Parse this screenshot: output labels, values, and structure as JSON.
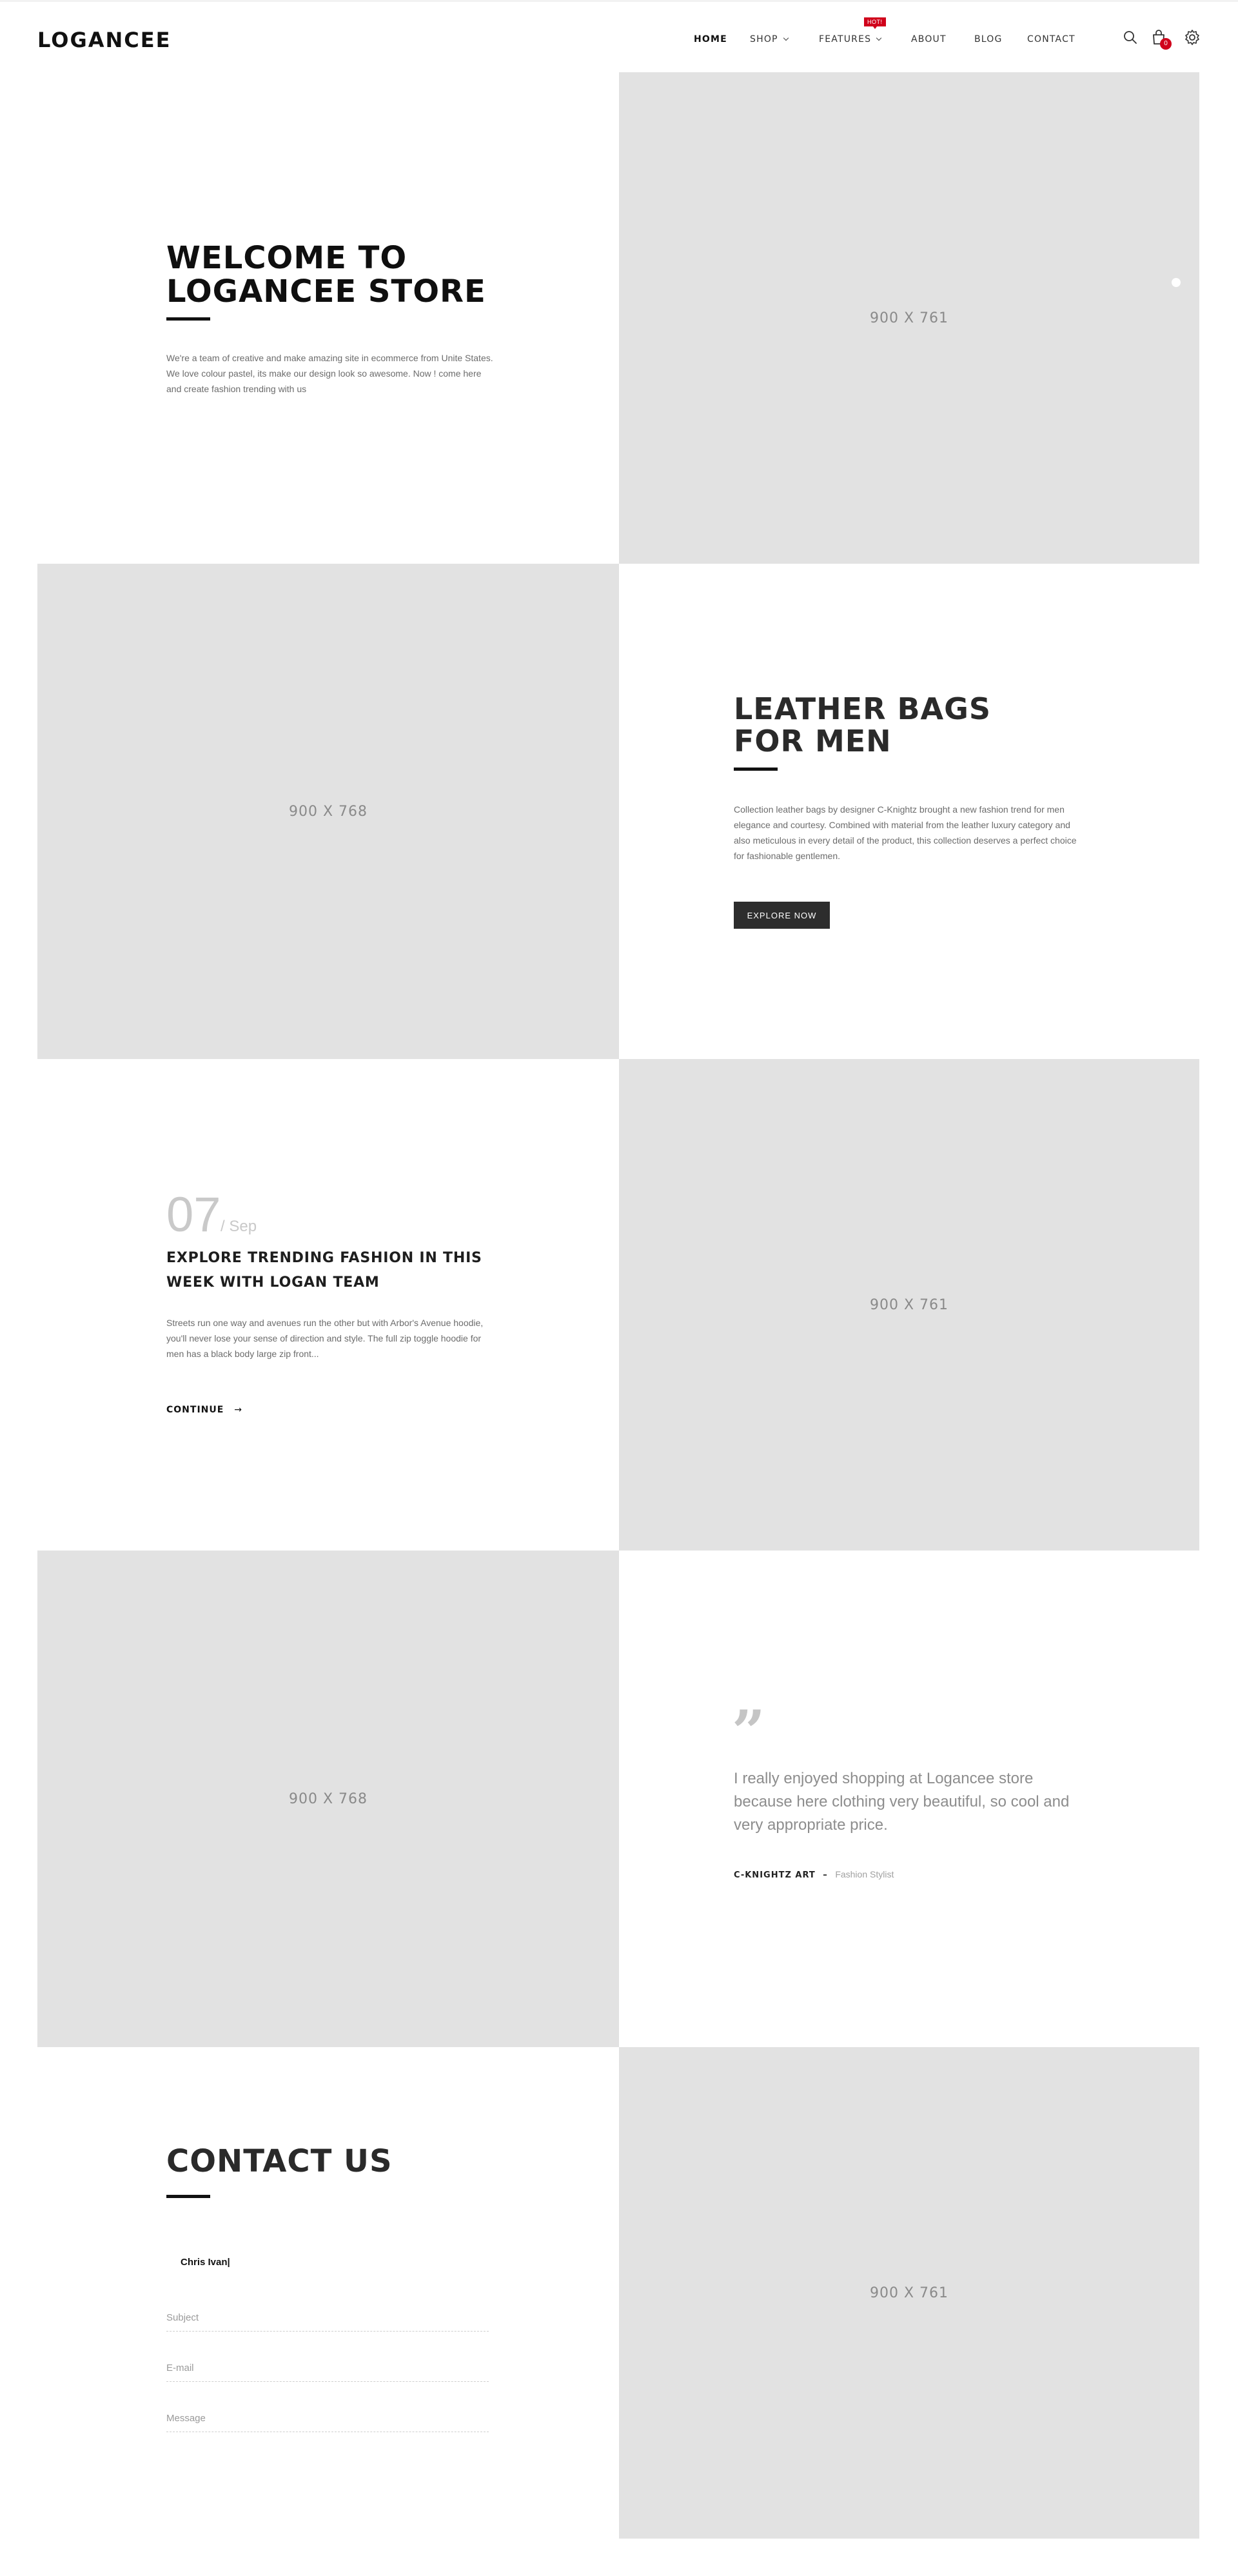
{
  "header": {
    "logo": "LOGANCEE",
    "nav": [
      {
        "label": "HOME"
      },
      {
        "label": "SHOP"
      },
      {
        "label": "FEATURES"
      },
      {
        "label": "ABOUT"
      },
      {
        "label": "BLOG"
      },
      {
        "label": "CONTACT"
      }
    ],
    "hot_badge": "HOT!",
    "cart_count": "0",
    "icons": [
      "search-icon",
      "cart-icon",
      "settings-icon"
    ],
    "badge_color": "#d0021b"
  },
  "hero": {
    "title_line1": "WELCOME TO",
    "title_line2": "LOGANCEE STORE",
    "description": "We're a team of creative and make amazing site in ecommerce from Unite States. We love colour pastel, its make our design look so awesome. Now ! come here and create fashion trending with us",
    "image_label": "900 X 761"
  },
  "leather": {
    "image_label": "900 X 768",
    "title_line1": "LEATHER BAGS",
    "title_line2": "FOR MEN",
    "description": "Collection leather bags by designer C-Knightz brought a new fashion trend for men elegance and courtesy. Combined with material from the leather luxury category and also meticulous in every detail of the product, this collection deserves a perfect choice for fashionable gentlemen.",
    "button": "EXPLORE NOW"
  },
  "post": {
    "day": "07",
    "month": "/ Sep",
    "title": "EXPLORE TRENDING FASHION IN THIS WEEK WITH LOGAN TEAM",
    "excerpt": "Streets run one way and avenues run the other but with Arbor's Avenue hoodie, you'll never lose your sense of direction and style. The full zip toggle hoodie for men has a black body large zip front...",
    "continue": "CONTINUE",
    "image_label": "900 X 761"
  },
  "testimonial": {
    "image_label": "900 X 768",
    "quote_mark": "”",
    "quote": "I really enjoyed shopping at Logancee store because here clothing very beautiful, so cool and very appropriate price.",
    "author": "C-KNIGHTZ ART",
    "separator": "–",
    "role": "Fashion Stylist"
  },
  "contact": {
    "title": "CONTACT US",
    "name_value": "Chris Ivan|",
    "subject_placeholder": "Subject",
    "email_placeholder": "E-mail",
    "message_placeholder": "Message",
    "image_label": "900 X 761"
  }
}
